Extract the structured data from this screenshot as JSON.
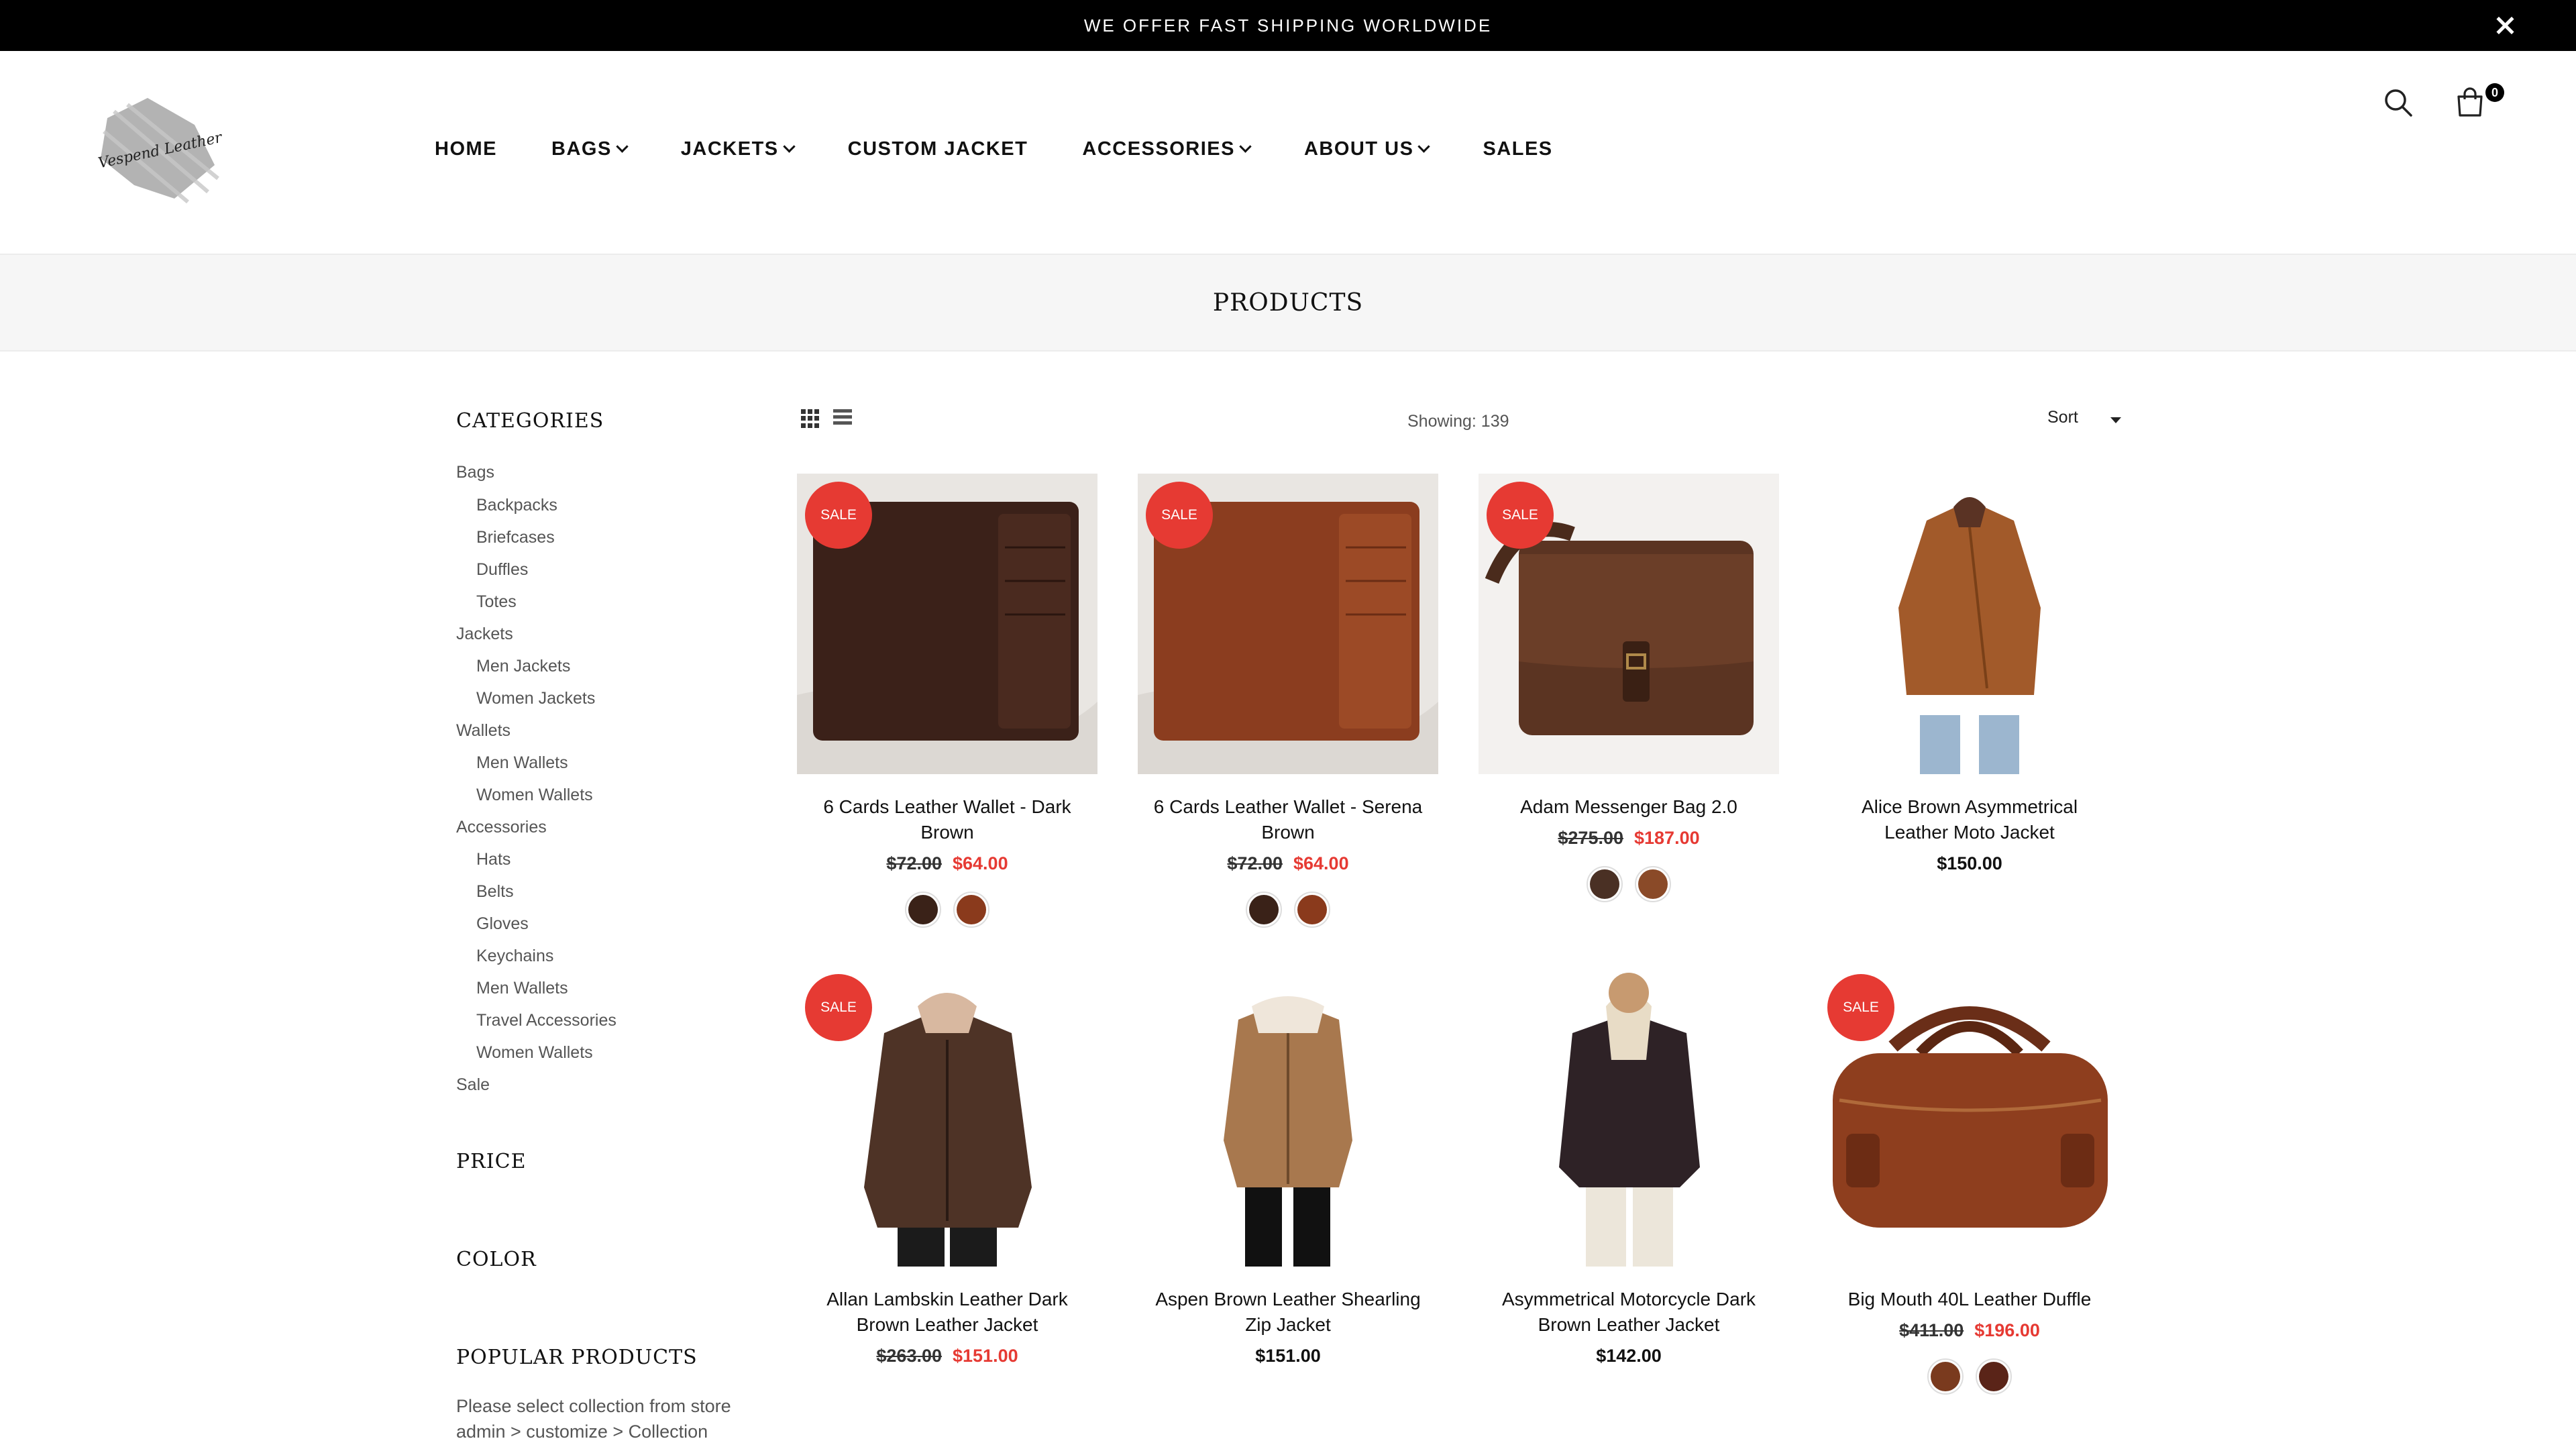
{
  "announcement": {
    "text": "WE OFFER FAST SHIPPING WORLDWIDE"
  },
  "brand": {
    "logo_text": "Vespend Leather"
  },
  "nav": {
    "items": [
      {
        "label": "HOME",
        "dropdown": false
      },
      {
        "label": "BAGS",
        "dropdown": true
      },
      {
        "label": "JACKETS",
        "dropdown": true
      },
      {
        "label": "CUSTOM JACKET",
        "dropdown": false
      },
      {
        "label": "ACCESSORIES",
        "dropdown": true
      },
      {
        "label": "ABOUT US",
        "dropdown": true
      },
      {
        "label": "SALES",
        "dropdown": false
      }
    ],
    "cart_count": "0"
  },
  "page": {
    "title": "PRODUCTS"
  },
  "sidebar": {
    "categories_heading": "CATEGORIES",
    "categories": [
      {
        "label": "Bags",
        "children": [
          "Backpacks",
          "Briefcases",
          "Duffles",
          "Totes"
        ]
      },
      {
        "label": "Jackets",
        "children": [
          "Men Jackets",
          "Women Jackets"
        ]
      },
      {
        "label": "Wallets",
        "children": [
          "Men Wallets",
          "Women Wallets"
        ]
      },
      {
        "label": "Accessories",
        "children": [
          "Hats",
          "Belts",
          "Gloves",
          "Keychains",
          "Men Wallets",
          "Travel Accessories",
          "Women Wallets"
        ]
      },
      {
        "label": "Sale",
        "children": []
      }
    ],
    "price_heading": "PRICE",
    "color_heading": "COLOR",
    "popular_heading": "POPULAR PRODUCTS",
    "popular_note_1": "Please select collection from store",
    "popular_note_2": "admin > customize > Collection"
  },
  "toolbar": {
    "showing": "Showing: 139",
    "sort_label": "Sort"
  },
  "colors": {
    "accent": "#e63a33",
    "announcement_bg": "#000000",
    "band_bg": "#f6f6f6"
  },
  "products": [
    {
      "name": "6 Cards Leather Wallet - Dark Brown",
      "sale": "SALE",
      "old_price": "$72.00",
      "price": "$64.00",
      "swatches": [
        "#3a2218",
        "#8a3a1c"
      ]
    },
    {
      "name": "6 Cards Leather Wallet - Serena Brown",
      "sale": "SALE",
      "old_price": "$72.00",
      "price": "$64.00",
      "swatches": [
        "#3a2218",
        "#8a3a1c"
      ]
    },
    {
      "name": "Adam Messenger Bag 2.0",
      "sale": "SALE",
      "old_price": "$275.00",
      "price": "$187.00",
      "swatches": [
        "#4a3024",
        "#8a4a28"
      ]
    },
    {
      "name": "Alice Brown Asymmetrical Leather Moto Jacket",
      "sale": "",
      "old_price": "",
      "price": "$150.00",
      "swatches": []
    },
    {
      "name": "Allan Lambskin Leather Dark Brown Leather Jacket",
      "sale": "SALE",
      "old_price": "$263.00",
      "price": "$151.00",
      "swatches": []
    },
    {
      "name": "Aspen Brown Leather Shearling Zip Jacket",
      "sale": "",
      "old_price": "",
      "price": "$151.00",
      "swatches": []
    },
    {
      "name": "Asymmetrical Motorcycle Dark Brown Leather Jacket",
      "sale": "",
      "old_price": "",
      "price": "$142.00",
      "swatches": []
    },
    {
      "name": "Big Mouth 40L Leather Duffle",
      "sale": "SALE",
      "old_price": "$411.00",
      "price": "$196.00",
      "swatches": [
        "#7a3a1e",
        "#5a2418"
      ]
    }
  ]
}
